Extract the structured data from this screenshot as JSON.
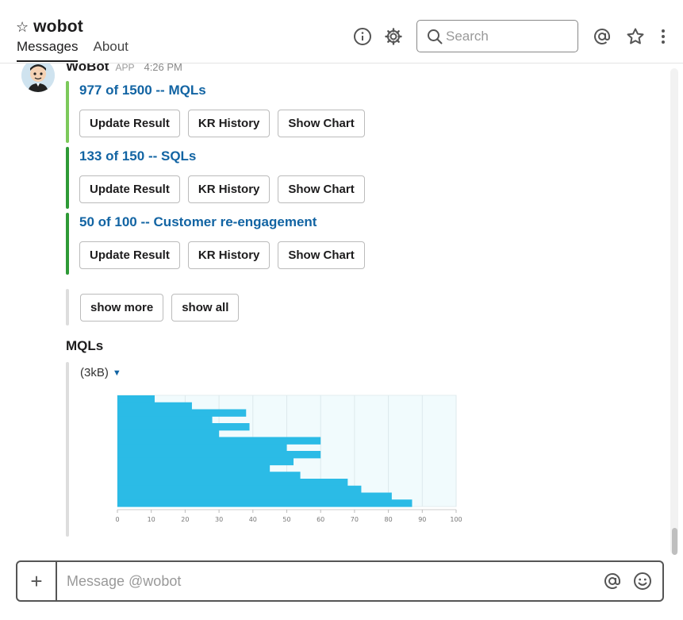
{
  "header": {
    "channel_name": "wobot",
    "tabs": [
      {
        "label": "Messages",
        "active": true
      },
      {
        "label": "About",
        "active": false
      }
    ],
    "search_placeholder": "Search"
  },
  "message": {
    "sender": "WoBot",
    "badge": "APP",
    "time": "4:26 PM",
    "krs": [
      {
        "title": "977 of 1500 -- MQLs",
        "bar_color": "#7cc95a"
      },
      {
        "title": "133 of 150 -- SQLs",
        "bar_color": "#2e9a36"
      },
      {
        "title": "50 of 100 -- Customer re-engagement",
        "bar_color": "#2e9a36"
      }
    ],
    "buttons": {
      "update": "Update Result",
      "history": "KR History",
      "chart": "Show Chart"
    },
    "show_more": "show more",
    "show_all": "show all"
  },
  "attachment": {
    "title": "MQLs",
    "size": "(3kB)"
  },
  "chart_data": {
    "type": "area",
    "orientation": "horizontal",
    "color": "#2bbbe6",
    "xlim": [
      0,
      100
    ],
    "x_ticks": [
      "0",
      "10",
      "20",
      "30",
      "40",
      "50",
      "60",
      "70",
      "80",
      "90",
      "100"
    ],
    "values": [
      11,
      22,
      38,
      28,
      39,
      30,
      60,
      50,
      60,
      52,
      45,
      54,
      68,
      72,
      81,
      87
    ],
    "grid": true
  },
  "composer": {
    "placeholder": "Message @wobot"
  },
  "colors": {
    "link": "#1264a3",
    "chart_bg": "#f1fbfd",
    "chart_fill": "#2bbbe6"
  }
}
